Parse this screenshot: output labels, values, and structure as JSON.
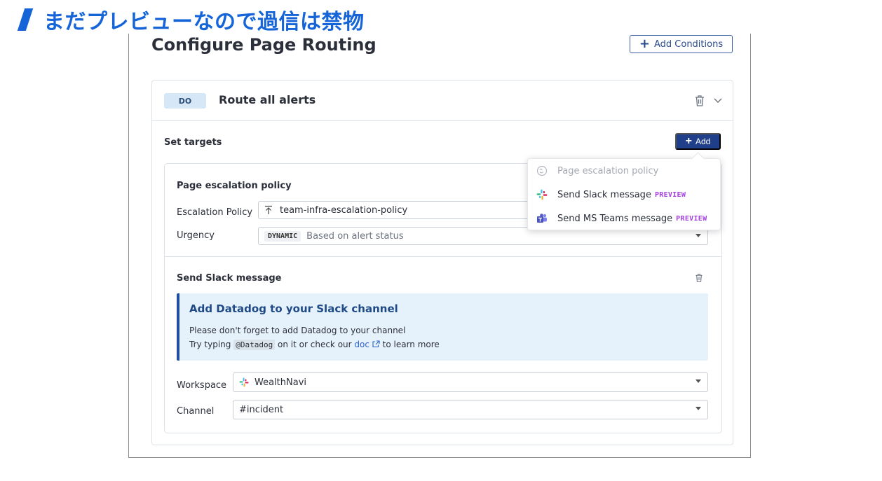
{
  "slide": {
    "title": "まだプレビューなので過信は禁物"
  },
  "page": {
    "heading": "Configure Page Routing",
    "add_conditions_label": "Add Conditions"
  },
  "rule": {
    "badge": "DO",
    "title": "Route all alerts"
  },
  "targets": {
    "label": "Set targets",
    "add_label": "Add"
  },
  "escalation": {
    "title": "Page escalation policy",
    "policy_label": "Escalation Policy",
    "policy_value": "team-infra-escalation-policy",
    "urgency_label": "Urgency",
    "urgency_tag": "DYNAMIC",
    "urgency_value": "Based on alert status"
  },
  "slack": {
    "title": "Send Slack message",
    "info_title": "Add Datadog to your Slack channel",
    "info_line1": "Please don't forget to add Datadog to your channel",
    "info_line2_a": "Try typing",
    "info_code": "@Datadog",
    "info_line2_b": "on it or check our",
    "info_link": "doc",
    "info_line2_c": "to learn more",
    "workspace_label": "Workspace",
    "workspace_value": "WealthNavi",
    "channel_label": "Channel",
    "channel_value": "#incident"
  },
  "menu": {
    "items": [
      {
        "label": "Page escalation policy",
        "icon": "escalation-icon",
        "disabled": true,
        "tag": ""
      },
      {
        "label": "Send Slack message",
        "icon": "slack-icon",
        "disabled": false,
        "tag": "PREVIEW"
      },
      {
        "label": "Send MS Teams message",
        "icon": "teams-icon",
        "disabled": false,
        "tag": "PREVIEW"
      }
    ]
  },
  "colors": {
    "accent": "#1565d8",
    "primary_button": "#1f3f8a",
    "preview_tag": "#a03fdc",
    "info_bg": "#e6f2fb"
  }
}
